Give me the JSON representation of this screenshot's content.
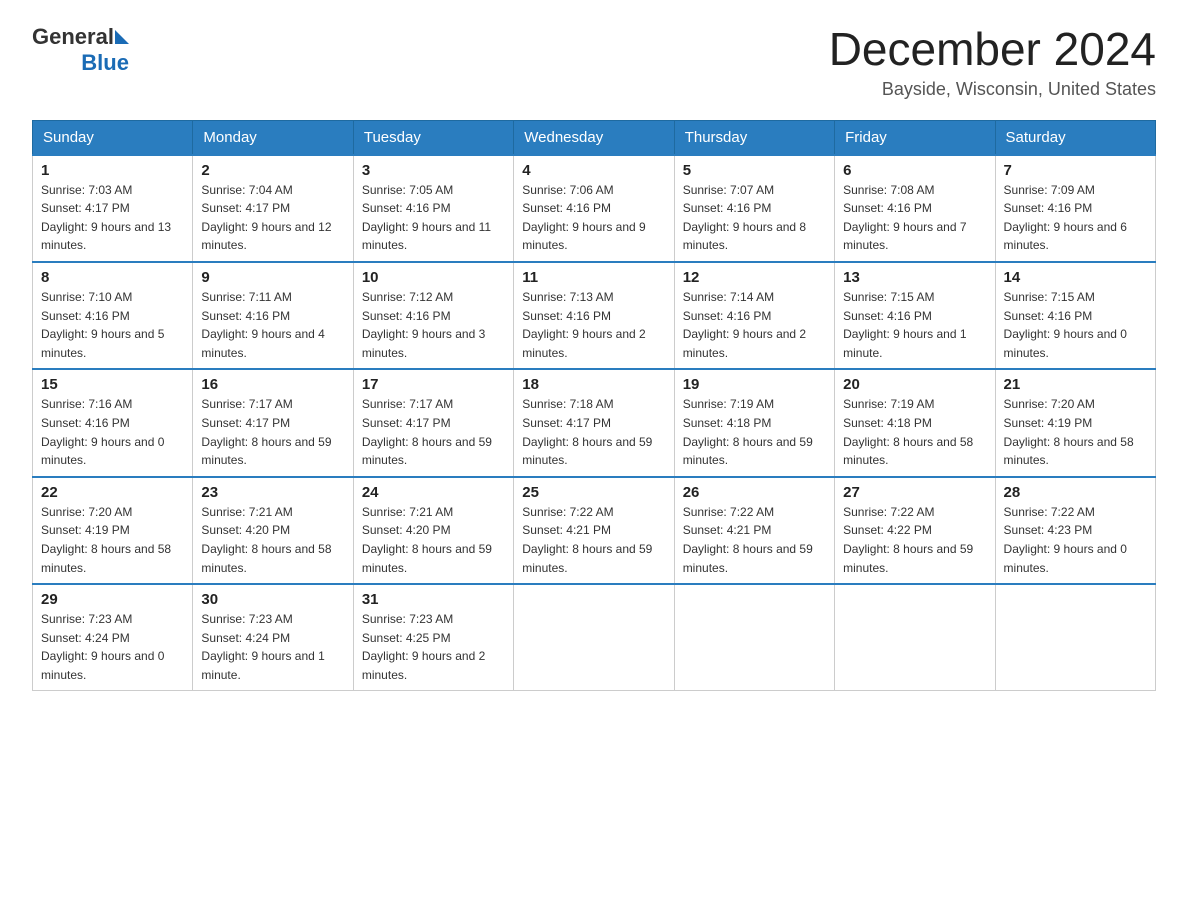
{
  "header": {
    "logo_general": "General",
    "logo_blue": "Blue",
    "month_year": "December 2024",
    "location": "Bayside, Wisconsin, United States"
  },
  "days_of_week": [
    "Sunday",
    "Monday",
    "Tuesday",
    "Wednesday",
    "Thursday",
    "Friday",
    "Saturday"
  ],
  "weeks": [
    [
      {
        "day": "1",
        "sunrise": "7:03 AM",
        "sunset": "4:17 PM",
        "daylight": "9 hours and 13 minutes."
      },
      {
        "day": "2",
        "sunrise": "7:04 AM",
        "sunset": "4:17 PM",
        "daylight": "9 hours and 12 minutes."
      },
      {
        "day": "3",
        "sunrise": "7:05 AM",
        "sunset": "4:16 PM",
        "daylight": "9 hours and 11 minutes."
      },
      {
        "day": "4",
        "sunrise": "7:06 AM",
        "sunset": "4:16 PM",
        "daylight": "9 hours and 9 minutes."
      },
      {
        "day": "5",
        "sunrise": "7:07 AM",
        "sunset": "4:16 PM",
        "daylight": "9 hours and 8 minutes."
      },
      {
        "day": "6",
        "sunrise": "7:08 AM",
        "sunset": "4:16 PM",
        "daylight": "9 hours and 7 minutes."
      },
      {
        "day": "7",
        "sunrise": "7:09 AM",
        "sunset": "4:16 PM",
        "daylight": "9 hours and 6 minutes."
      }
    ],
    [
      {
        "day": "8",
        "sunrise": "7:10 AM",
        "sunset": "4:16 PM",
        "daylight": "9 hours and 5 minutes."
      },
      {
        "day": "9",
        "sunrise": "7:11 AM",
        "sunset": "4:16 PM",
        "daylight": "9 hours and 4 minutes."
      },
      {
        "day": "10",
        "sunrise": "7:12 AM",
        "sunset": "4:16 PM",
        "daylight": "9 hours and 3 minutes."
      },
      {
        "day": "11",
        "sunrise": "7:13 AM",
        "sunset": "4:16 PM",
        "daylight": "9 hours and 2 minutes."
      },
      {
        "day": "12",
        "sunrise": "7:14 AM",
        "sunset": "4:16 PM",
        "daylight": "9 hours and 2 minutes."
      },
      {
        "day": "13",
        "sunrise": "7:15 AM",
        "sunset": "4:16 PM",
        "daylight": "9 hours and 1 minute."
      },
      {
        "day": "14",
        "sunrise": "7:15 AM",
        "sunset": "4:16 PM",
        "daylight": "9 hours and 0 minutes."
      }
    ],
    [
      {
        "day": "15",
        "sunrise": "7:16 AM",
        "sunset": "4:16 PM",
        "daylight": "9 hours and 0 minutes."
      },
      {
        "day": "16",
        "sunrise": "7:17 AM",
        "sunset": "4:17 PM",
        "daylight": "8 hours and 59 minutes."
      },
      {
        "day": "17",
        "sunrise": "7:17 AM",
        "sunset": "4:17 PM",
        "daylight": "8 hours and 59 minutes."
      },
      {
        "day": "18",
        "sunrise": "7:18 AM",
        "sunset": "4:17 PM",
        "daylight": "8 hours and 59 minutes."
      },
      {
        "day": "19",
        "sunrise": "7:19 AM",
        "sunset": "4:18 PM",
        "daylight": "8 hours and 59 minutes."
      },
      {
        "day": "20",
        "sunrise": "7:19 AM",
        "sunset": "4:18 PM",
        "daylight": "8 hours and 58 minutes."
      },
      {
        "day": "21",
        "sunrise": "7:20 AM",
        "sunset": "4:19 PM",
        "daylight": "8 hours and 58 minutes."
      }
    ],
    [
      {
        "day": "22",
        "sunrise": "7:20 AM",
        "sunset": "4:19 PM",
        "daylight": "8 hours and 58 minutes."
      },
      {
        "day": "23",
        "sunrise": "7:21 AM",
        "sunset": "4:20 PM",
        "daylight": "8 hours and 58 minutes."
      },
      {
        "day": "24",
        "sunrise": "7:21 AM",
        "sunset": "4:20 PM",
        "daylight": "8 hours and 59 minutes."
      },
      {
        "day": "25",
        "sunrise": "7:22 AM",
        "sunset": "4:21 PM",
        "daylight": "8 hours and 59 minutes."
      },
      {
        "day": "26",
        "sunrise": "7:22 AM",
        "sunset": "4:21 PM",
        "daylight": "8 hours and 59 minutes."
      },
      {
        "day": "27",
        "sunrise": "7:22 AM",
        "sunset": "4:22 PM",
        "daylight": "8 hours and 59 minutes."
      },
      {
        "day": "28",
        "sunrise": "7:22 AM",
        "sunset": "4:23 PM",
        "daylight": "9 hours and 0 minutes."
      }
    ],
    [
      {
        "day": "29",
        "sunrise": "7:23 AM",
        "sunset": "4:24 PM",
        "daylight": "9 hours and 0 minutes."
      },
      {
        "day": "30",
        "sunrise": "7:23 AM",
        "sunset": "4:24 PM",
        "daylight": "9 hours and 1 minute."
      },
      {
        "day": "31",
        "sunrise": "7:23 AM",
        "sunset": "4:25 PM",
        "daylight": "9 hours and 2 minutes."
      },
      null,
      null,
      null,
      null
    ]
  ]
}
